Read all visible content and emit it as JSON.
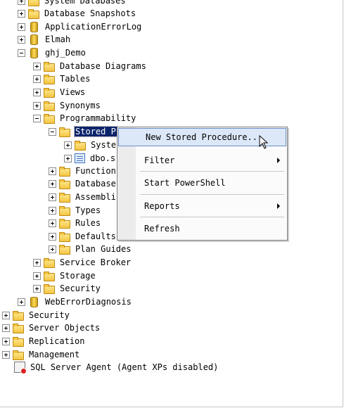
{
  "tree": {
    "items": [
      {
        "label": "System Databases",
        "expander": "plus",
        "icon": "folder-icon"
      },
      {
        "label": "Database Snapshots",
        "expander": "plus",
        "icon": "folder-icon"
      },
      {
        "label": "ApplicationErrorLog",
        "expander": "plus",
        "icon": "database-icon"
      },
      {
        "label": "Elmah",
        "expander": "plus",
        "icon": "database-icon"
      },
      {
        "label": "ghj_Demo",
        "expander": "minus",
        "icon": "database-icon"
      },
      {
        "label": "Database Diagrams",
        "expander": "plus",
        "icon": "folder-icon"
      },
      {
        "label": "Tables",
        "expander": "plus",
        "icon": "folder-icon"
      },
      {
        "label": "Views",
        "expander": "plus",
        "icon": "folder-icon"
      },
      {
        "label": "Synonyms",
        "expander": "plus",
        "icon": "folder-icon"
      },
      {
        "label": "Programmability",
        "expander": "minus",
        "icon": "folder-icon"
      },
      {
        "label": "Stored P",
        "expander": "minus",
        "icon": "folder-icon",
        "selected": true
      },
      {
        "label": "Syste",
        "expander": "plus",
        "icon": "folder-icon"
      },
      {
        "label": "dbo.s",
        "expander": "plus",
        "icon": "stored-procedure-icon"
      },
      {
        "label": "Function",
        "expander": "plus",
        "icon": "folder-icon"
      },
      {
        "label": "Database",
        "expander": "plus",
        "icon": "folder-icon"
      },
      {
        "label": "Assembli",
        "expander": "plus",
        "icon": "folder-icon"
      },
      {
        "label": "Types",
        "expander": "plus",
        "icon": "folder-icon"
      },
      {
        "label": "Rules",
        "expander": "plus",
        "icon": "folder-icon"
      },
      {
        "label": "Defaults",
        "expander": "plus",
        "icon": "folder-icon"
      },
      {
        "label": "Plan Guides",
        "expander": "plus",
        "icon": "folder-icon"
      },
      {
        "label": "Service Broker",
        "expander": "plus",
        "icon": "folder-icon"
      },
      {
        "label": "Storage",
        "expander": "plus",
        "icon": "folder-icon"
      },
      {
        "label": "Security",
        "expander": "plus",
        "icon": "folder-icon"
      },
      {
        "label": "WebErrorDiagnosis",
        "expander": "plus",
        "icon": "database-icon"
      },
      {
        "label": "Security",
        "expander": "plus",
        "icon": "folder-icon"
      },
      {
        "label": "Server Objects",
        "expander": "plus",
        "icon": "folder-icon"
      },
      {
        "label": "Replication",
        "expander": "plus",
        "icon": "folder-icon"
      },
      {
        "label": "Management",
        "expander": "plus",
        "icon": "folder-icon"
      },
      {
        "label": "SQL Server Agent (Agent XPs disabled)",
        "expander": "none",
        "icon": "sql-agent-icon"
      }
    ]
  },
  "context_menu": {
    "items": [
      {
        "label": "New Stored Procedure...",
        "highlighted": true,
        "submenu": false
      },
      {
        "label": "Filter",
        "highlighted": false,
        "submenu": true
      },
      {
        "label": "Start PowerShell",
        "highlighted": false,
        "submenu": false
      },
      {
        "label": "Reports",
        "highlighted": false,
        "submenu": true
      },
      {
        "label": "Refresh",
        "highlighted": false,
        "submenu": false
      }
    ]
  }
}
